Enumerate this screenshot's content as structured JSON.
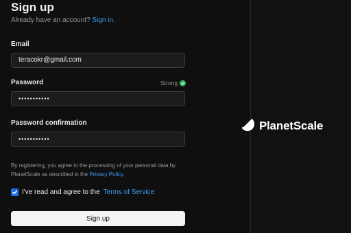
{
  "header": {
    "title": "Sign up",
    "prompt": "Already have an account?",
    "signin_link": "Sign in."
  },
  "form": {
    "email": {
      "label": "Email",
      "value": "teracokr@gmail.com"
    },
    "password": {
      "label": "Password",
      "value": "•••••••••••",
      "strength": "Strong"
    },
    "password_confirmation": {
      "label": "Password confirmation",
      "value": "•••••••••••"
    },
    "legal_text": "By registering, you agree to the processing of your personal data by PlanetScale as described in the",
    "privacy_link": "Privacy Policy",
    "legal_end": ".",
    "agree": {
      "checked": true,
      "text": "I've read and agree to the",
      "terms_link": "Terms of Service"
    },
    "submit_label": "Sign up"
  },
  "brand": {
    "name": "PlanetScale",
    "icon": "planetscale-logo-icon"
  },
  "colors": {
    "background": "#0f0f0f",
    "link": "#3b9ff5",
    "success": "#33b35e",
    "checkbox": "#1f6fe0",
    "button": "#f4f4f4"
  }
}
